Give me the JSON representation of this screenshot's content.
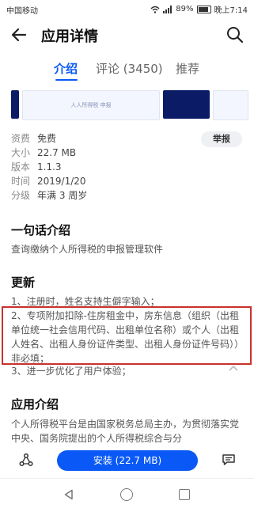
{
  "status_bar": {
    "carrier": "中国移动",
    "battery": "89%",
    "time": "晚上7:14",
    "icons": [
      "wifi-icon",
      "signal-icon",
      "battery-icon"
    ]
  },
  "app_bar": {
    "title": "应用详情",
    "back_icon": "arrow-left-icon",
    "search_icon": "search-icon"
  },
  "tabs": [
    {
      "label": "介绍",
      "active": true
    },
    {
      "label": "评论 (3450)",
      "active": false
    },
    {
      "label": "推荐",
      "active": false
    }
  ],
  "screenshots": {
    "caption": "人人所得税 申报"
  },
  "meta": {
    "rows": [
      {
        "key": "资费",
        "value": "免费"
      },
      {
        "key": "大小",
        "value": "22.7 MB"
      },
      {
        "key": "版本",
        "value": "1.1.3"
      },
      {
        "key": "时间",
        "value": "2019/1/20"
      },
      {
        "key": "分级",
        "value": "年满 3 周岁"
      }
    ],
    "report_label": "举报"
  },
  "one_line": {
    "title": "一句话介绍",
    "text": "查询缴纳个人所得税的申报管理软件"
  },
  "update": {
    "title": "更新",
    "items": [
      "1、注册时，姓名支持生僻字输入；",
      "2、专项附加扣除-住房租金中，房东信息（组织（出租单位统一社会信用代码、出租单位名称）或个人（出租人姓名、出租人身份证件类型、出租人身份证件号码））非必填；",
      "3、进一步优化了用户体验；"
    ]
  },
  "intro": {
    "title": "应用介绍",
    "text": "个人所得税平台是由国家税务总局主办，为贯彻落实党中央、国务院提出的个人所得税综合与分"
  },
  "bottom_bar": {
    "install_label": "安装 (22.7 MB)"
  },
  "colors": {
    "accent": "#0a59f7",
    "highlight_border": "#c8322d"
  }
}
